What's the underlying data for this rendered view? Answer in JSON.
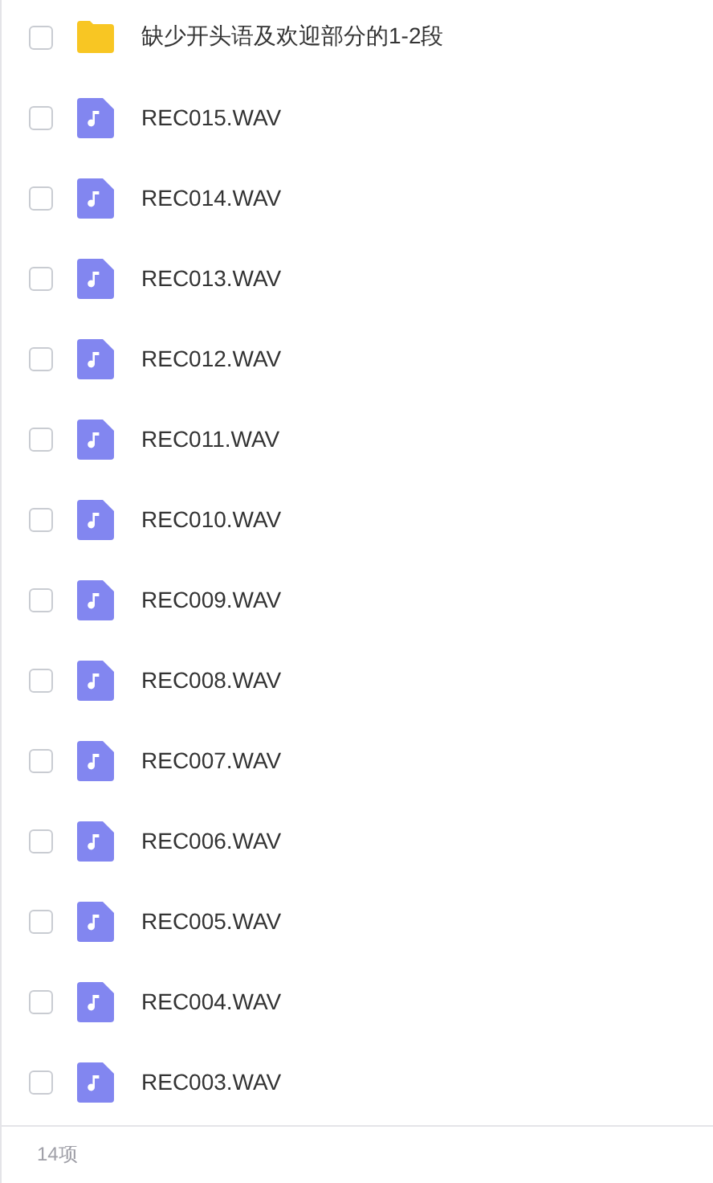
{
  "files": [
    {
      "kind": "folder",
      "name": "缺少开头语及欢迎部分的1-2段",
      "checked": false
    },
    {
      "kind": "audio",
      "name": "REC015.WAV",
      "checked": false
    },
    {
      "kind": "audio",
      "name": "REC014.WAV",
      "checked": false
    },
    {
      "kind": "audio",
      "name": "REC013.WAV",
      "checked": false
    },
    {
      "kind": "audio",
      "name": "REC012.WAV",
      "checked": false
    },
    {
      "kind": "audio",
      "name": "REC011.WAV",
      "checked": false
    },
    {
      "kind": "audio",
      "name": "REC010.WAV",
      "checked": false
    },
    {
      "kind": "audio",
      "name": "REC009.WAV",
      "checked": false
    },
    {
      "kind": "audio",
      "name": "REC008.WAV",
      "checked": false
    },
    {
      "kind": "audio",
      "name": "REC007.WAV",
      "checked": false
    },
    {
      "kind": "audio",
      "name": "REC006.WAV",
      "checked": false
    },
    {
      "kind": "audio",
      "name": "REC005.WAV",
      "checked": false
    },
    {
      "kind": "audio",
      "name": "REC004.WAV",
      "checked": false
    },
    {
      "kind": "audio",
      "name": "REC003.WAV",
      "checked": false
    }
  ],
  "footer": {
    "count": "14项"
  }
}
